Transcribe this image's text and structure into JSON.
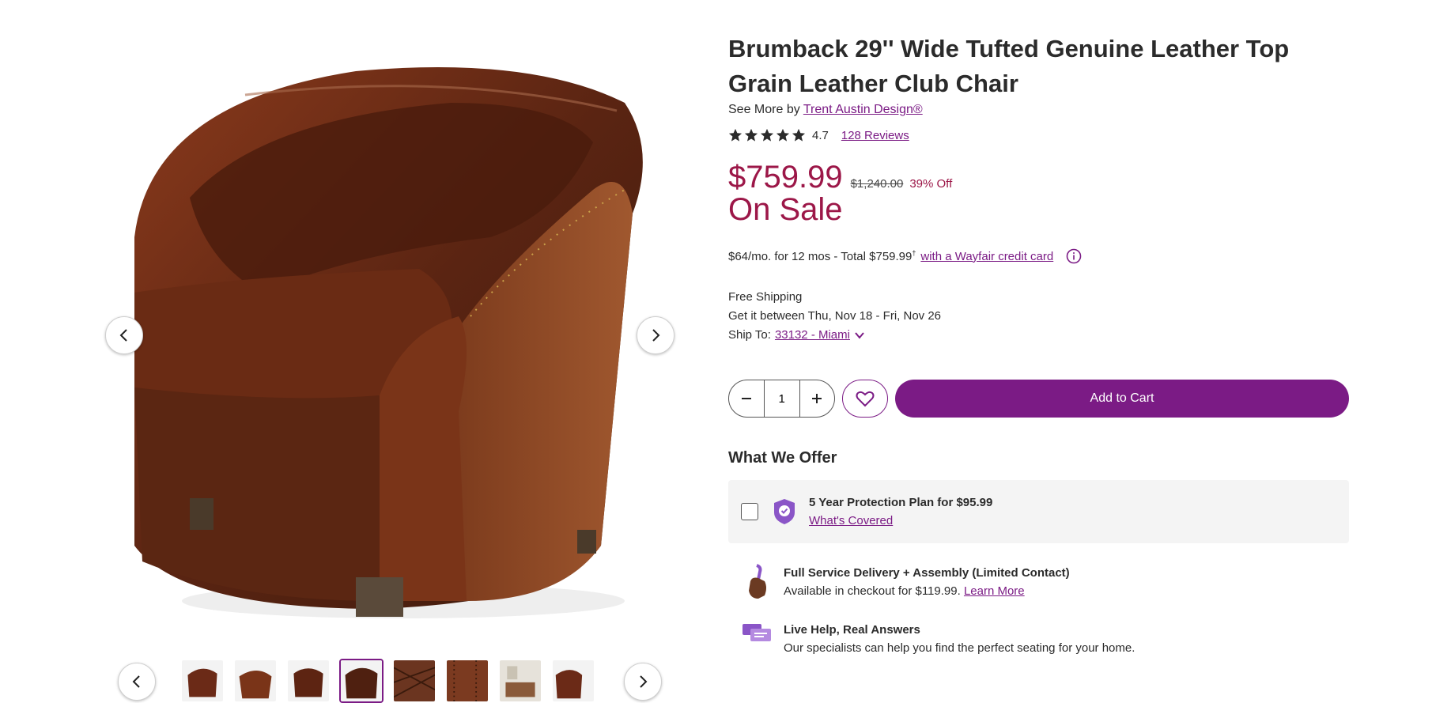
{
  "product": {
    "title": "Brumback 29'' Wide Tufted Genuine Leather Top Grain Leather Club Chair",
    "see_more_prefix": "See More by",
    "brand": "Trent Austin Design®",
    "rating": "4.7",
    "rating_value": 4.7,
    "reviews_label": "128 Reviews"
  },
  "pricing": {
    "price": "$759.99",
    "original_price": "$1,240.00",
    "discount": "39% Off",
    "sale_label": "On Sale",
    "financing_text": "$64/mo. for 12 mos - Total $759.99",
    "financing_sup": "†",
    "financing_link": "with a Wayfair credit card"
  },
  "shipping": {
    "free_label": "Free Shipping",
    "delivery_window": "Get it between Thu, Nov 18 - Fri, Nov 26",
    "ship_to_label": "Ship To:",
    "ship_to_location": "33132 - Miami"
  },
  "cart": {
    "quantity": "1",
    "add_to_cart_label": "Add to Cart"
  },
  "offers": {
    "heading": "What We Offer",
    "protection_title": "5 Year Protection Plan for $95.99",
    "protection_link": "What's Covered",
    "delivery_title": "Full Service Delivery + Assembly (Limited Contact)",
    "delivery_text": "Available in checkout for $119.99.",
    "delivery_link": "Learn More",
    "help_title": "Live Help, Real Answers",
    "help_text": "Our specialists can help you find the perfect seating for your home."
  },
  "gallery": {
    "thumbnail_count": 8,
    "active_thumbnail": 4
  },
  "colors": {
    "brand_purple": "#7b1b85",
    "sale_red": "#9c1748",
    "leather": "#6b2f1a"
  },
  "icons": [
    "chevron-left-icon",
    "chevron-right-icon",
    "star-icon",
    "info-icon",
    "chevron-down-icon",
    "minus-icon",
    "plus-icon",
    "heart-icon",
    "shield-check-icon",
    "assembly-hand-icon",
    "chat-icon"
  ]
}
